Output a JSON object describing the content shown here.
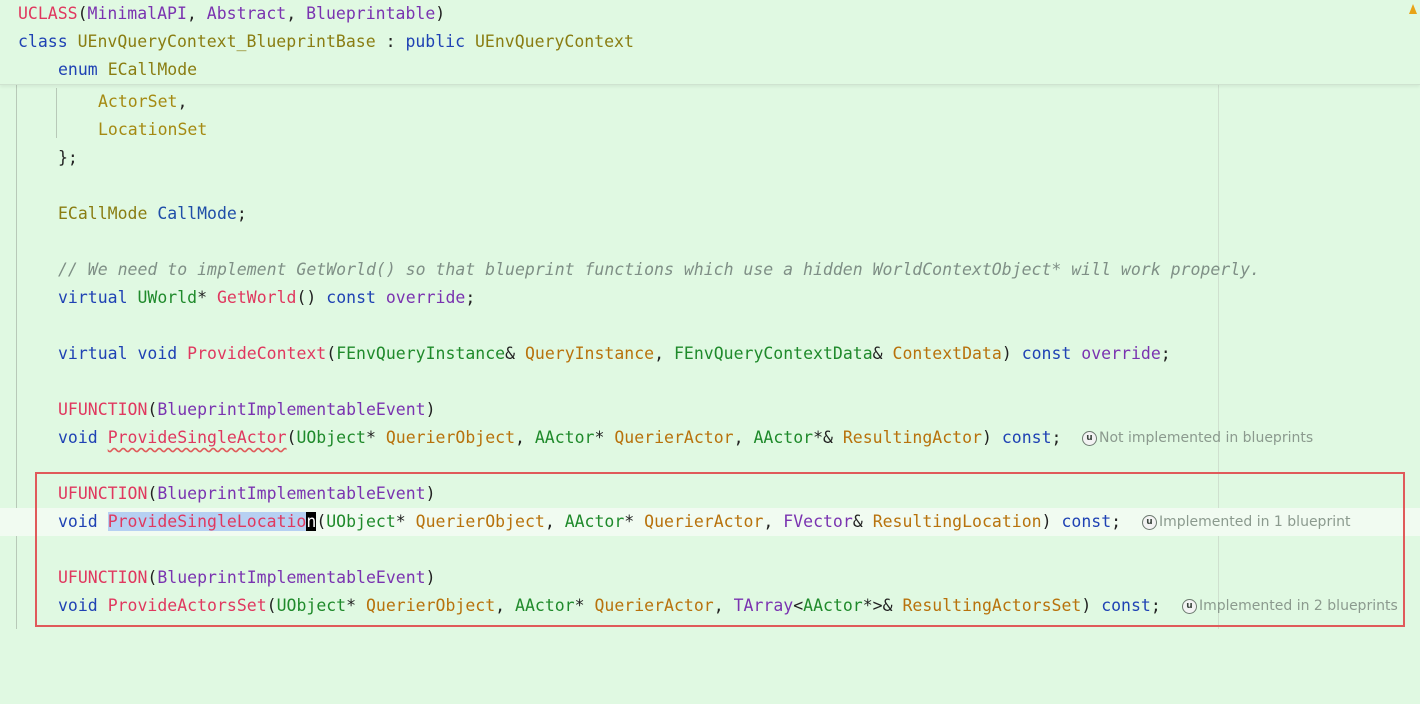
{
  "code": {
    "uclass_macro": "UCLASS",
    "uclass_args": [
      "MinimalAPI",
      "Abstract",
      "Blueprintable"
    ],
    "class_kw": "class",
    "class_name": "UEnvQueryContext_BlueprintBase",
    "public_kw": "public",
    "base_class": "UEnvQueryContext",
    "enum_kw": "enum",
    "enum_name": "ECallMode",
    "enum_values": [
      "ActorSet",
      "LocationSet"
    ],
    "enum_close": "};",
    "callmode_type": "ECallMode",
    "callmode_member": "CallMode",
    "comment": "// We need to implement GetWorld() so that blueprint functions which use a hidden WorldContextObject* will work properly.",
    "virtual_kw": "virtual",
    "uworld_type": "UWorld",
    "getworld_fn": "GetWorld",
    "const_kw": "const",
    "override_kw": "override",
    "void_kw": "void",
    "provide_context_fn": "ProvideContext",
    "instance_type": "FEnvQueryInstance",
    "instance_param": "QueryInstance",
    "context_data_type": "FEnvQueryContextData",
    "context_data_param": "ContextData",
    "ufunction_macro": "UFUNCTION",
    "ufunction_arg": "BlueprintImplementableEvent",
    "single_actor_fn": "ProvideSingleActor",
    "uobject_type": "UObject",
    "querier_object_param": "QuerierObject",
    "aactor_type": "AActor",
    "querier_actor_param": "QuerierActor",
    "resulting_actor_param": "ResultingActor",
    "single_location_fn_selected": "ProvideSingleLocatio",
    "single_location_fn_caret": "n",
    "fvector_type": "FVector",
    "resulting_location_param": "ResultingLocation",
    "actors_set_fn": "ProvideActorsSet",
    "tarray_type": "TArray",
    "resulting_actors_set_param": "ResultingActorsSet"
  },
  "hints": {
    "single_actor": "Not implemented in blueprints",
    "single_location": "Implemented in 1 blueprint",
    "actors_set": "Implemented in 2 blueprints",
    "icon_glyph": "u"
  },
  "colors": {
    "background": "#e0f9e2",
    "selection_border": "#e05a5a",
    "warning": "#e8a317"
  }
}
